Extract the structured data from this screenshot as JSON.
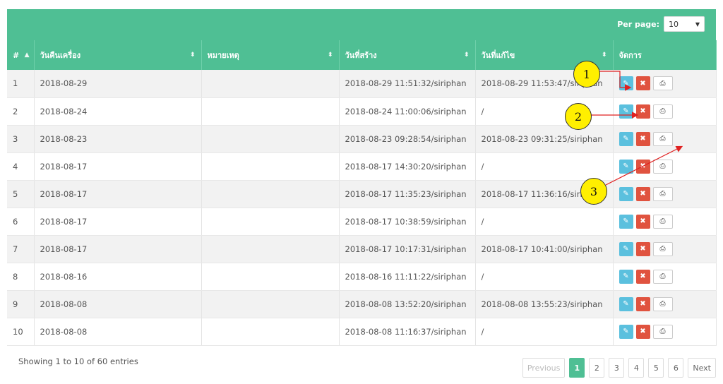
{
  "toolbar": {
    "per_page_label": "Per page:",
    "per_page_value": "10"
  },
  "columns": [
    "#",
    "วันคืนเครื่อง",
    "หมายเหตุ",
    "วันที่สร้าง",
    "วันที่แก้ไข",
    "จัดการ"
  ],
  "rows": [
    {
      "n": "1",
      "date": "2018-08-29",
      "note": "",
      "created": "2018-08-29 11:51:32/siriphan",
      "edited": "2018-08-29 11:53:47/siriphan"
    },
    {
      "n": "2",
      "date": "2018-08-24",
      "note": "",
      "created": "2018-08-24 11:00:06/siriphan",
      "edited": "/"
    },
    {
      "n": "3",
      "date": "2018-08-23",
      "note": "",
      "created": "2018-08-23 09:28:54/siriphan",
      "edited": "2018-08-23 09:31:25/siriphan"
    },
    {
      "n": "4",
      "date": "2018-08-17",
      "note": "",
      "created": "2018-08-17 14:30:20/siriphan",
      "edited": "/"
    },
    {
      "n": "5",
      "date": "2018-08-17",
      "note": "",
      "created": "2018-08-17 11:35:23/siriphan",
      "edited": "2018-08-17 11:36:16/siriphan"
    },
    {
      "n": "6",
      "date": "2018-08-17",
      "note": "",
      "created": "2018-08-17 10:38:59/siriphan",
      "edited": "/"
    },
    {
      "n": "7",
      "date": "2018-08-17",
      "note": "",
      "created": "2018-08-17 10:17:31/siriphan",
      "edited": "2018-08-17 10:41:00/siriphan"
    },
    {
      "n": "8",
      "date": "2018-08-16",
      "note": "",
      "created": "2018-08-16 11:11:22/siriphan",
      "edited": "/"
    },
    {
      "n": "9",
      "date": "2018-08-08",
      "note": "",
      "created": "2018-08-08 13:52:20/siriphan",
      "edited": "2018-08-08 13:55:23/siriphan"
    },
    {
      "n": "10",
      "date": "2018-08-08",
      "note": "",
      "created": "2018-08-08 11:16:37/siriphan",
      "edited": "/"
    }
  ],
  "footer": {
    "showing": "Showing 1 to 10 of 60 entries",
    "previous": "Previous",
    "pages": [
      "1",
      "2",
      "3",
      "4",
      "5",
      "6"
    ],
    "next": "Next"
  },
  "callouts": [
    "1",
    "2",
    "3"
  ],
  "colors": {
    "header": "#4fbf94",
    "edit": "#5bc0de",
    "delete": "#e0533f",
    "callout": "#ffef00",
    "arrow": "#e02020"
  }
}
